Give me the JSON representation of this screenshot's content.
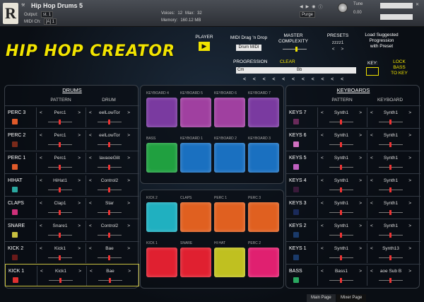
{
  "header": {
    "title": "Hip Hop Drums 5",
    "output_label": "Output:",
    "output_value": "st. 1",
    "midi_label": "MIDI Ch:",
    "midi_value": "[A] 1",
    "voices_label": "Voices:",
    "voices_value": "12",
    "max_label": "Max:",
    "max_value": "32",
    "memory_label": "Memory:",
    "memory_value": "160.12 MB",
    "purge": "Purge",
    "tune_label": "Tune",
    "tune_value": "0.00",
    "logo": "R"
  },
  "brand": "HIP HOP CREATOR",
  "player": {
    "label": "PLAYER"
  },
  "midi_drag": {
    "label": "MIDI Drag 'n Drop",
    "button": "Drum MIDI"
  },
  "master": {
    "label": "MASTER\nCOMPLEXITY"
  },
  "presets": {
    "label": "PRESETS",
    "value": "zzzz1"
  },
  "suggest": {
    "label": "Load Suggested\nProgression\nwith Preset"
  },
  "progression": {
    "label": "PROGRESSION",
    "clear": "CLEAR",
    "chord1": "Cm",
    "chord2": "Bb"
  },
  "key": {
    "label": "KEY:",
    "lock": "LOCK\nBASS\nTO KEY"
  },
  "drums": {
    "title": "DRUMS",
    "pattern_head": "PATTERN",
    "drum_head": "DRUM",
    "rows": [
      {
        "name": "PERC 3",
        "pattern": "Perc1",
        "drum": "eelLowTor",
        "color": "#e05a2a"
      },
      {
        "name": "PERC 2",
        "pattern": "Perc1",
        "drum": "eelLowTor",
        "color": "#7a2a1a"
      },
      {
        "name": "PERC 1",
        "pattern": "Perc1",
        "drum": "lavaoeGlit",
        "color": "#e05a2a"
      },
      {
        "name": "HIHAT",
        "pattern": "HiHat1",
        "drum": "Control2",
        "color": "#2aa8a0"
      },
      {
        "name": "CLAPS",
        "pattern": "Clap1",
        "drum": "Star",
        "color": "#d0307a"
      },
      {
        "name": "SNARE",
        "pattern": "Snare1",
        "drum": "Control2",
        "color": "#c8c040"
      },
      {
        "name": "KICK 2",
        "pattern": "Kick1",
        "drum": "Bae",
        "color": "#6a1a1a"
      },
      {
        "name": "KICK 1",
        "pattern": "Kick1",
        "drum": "Bae",
        "color": "#e03030"
      }
    ]
  },
  "keyboards": {
    "title": "KEYBOARDS",
    "pattern_head": "PATTERN",
    "keyboard_head": "KEYBOARD",
    "rows": [
      {
        "name": "KEYS 7",
        "pattern": "Synth1",
        "keyboard": "Synth1",
        "color": "#6a2a5a"
      },
      {
        "name": "KEYS 6",
        "pattern": "Synth1",
        "keyboard": "Synth1",
        "color": "#d070c0"
      },
      {
        "name": "KEYS 5",
        "pattern": "Synth1",
        "keyboard": "Synth1",
        "color": "#c060c0"
      },
      {
        "name": "KEYS 4",
        "pattern": "Synth1",
        "keyboard": "Synth1",
        "color": "#3a1a3a"
      },
      {
        "name": "KEYS 3",
        "pattern": "Synth1",
        "keyboard": "Synth1",
        "color": "#1a2a5a"
      },
      {
        "name": "KEYS 2",
        "pattern": "Synth1",
        "keyboard": "Synth1",
        "color": "#1a3a6a"
      },
      {
        "name": "KEYS 1",
        "pattern": "Synth1",
        "keyboard": "Synth13",
        "color": "#1a3a6a"
      },
      {
        "name": "BASS",
        "pattern": "Bass1",
        "keyboard": "aoe Sub B",
        "color": "#2aa860"
      }
    ]
  },
  "pads_top": [
    {
      "label": "KEYBOARD 4",
      "color": "#7a3aa0"
    },
    {
      "label": "KEYBOARD 5",
      "color": "#a040a0"
    },
    {
      "label": "KEYBOARD 6",
      "color": "#a040a0"
    },
    {
      "label": "KEYBOARD 7",
      "color": "#7a3aa0"
    },
    {
      "label": "BASS",
      "color": "#20a040"
    },
    {
      "label": "KEYBOARD 1",
      "color": "#1a70c0"
    },
    {
      "label": "KEYBOARD 2",
      "color": "#1a70c0"
    },
    {
      "label": "KEYBOARD 3",
      "color": "#1a70c0"
    }
  ],
  "pads_bottom": [
    {
      "label": "KICK 2",
      "color": "#20b0c0"
    },
    {
      "label": "CLAPS",
      "color": "#e06020"
    },
    {
      "label": "PERC 1",
      "color": "#e06020"
    },
    {
      "label": "PERC 3",
      "color": "#e06020"
    },
    {
      "label": "KICK 1",
      "color": "#e02030"
    },
    {
      "label": "SNARE",
      "color": "#e02030"
    },
    {
      "label": "HI HAT",
      "color": "#c0c020"
    },
    {
      "label": "PERC 2",
      "color": "#e02070"
    }
  ],
  "footer": {
    "main_page": "Main Page",
    "mixer_page": "Mixer Page"
  }
}
